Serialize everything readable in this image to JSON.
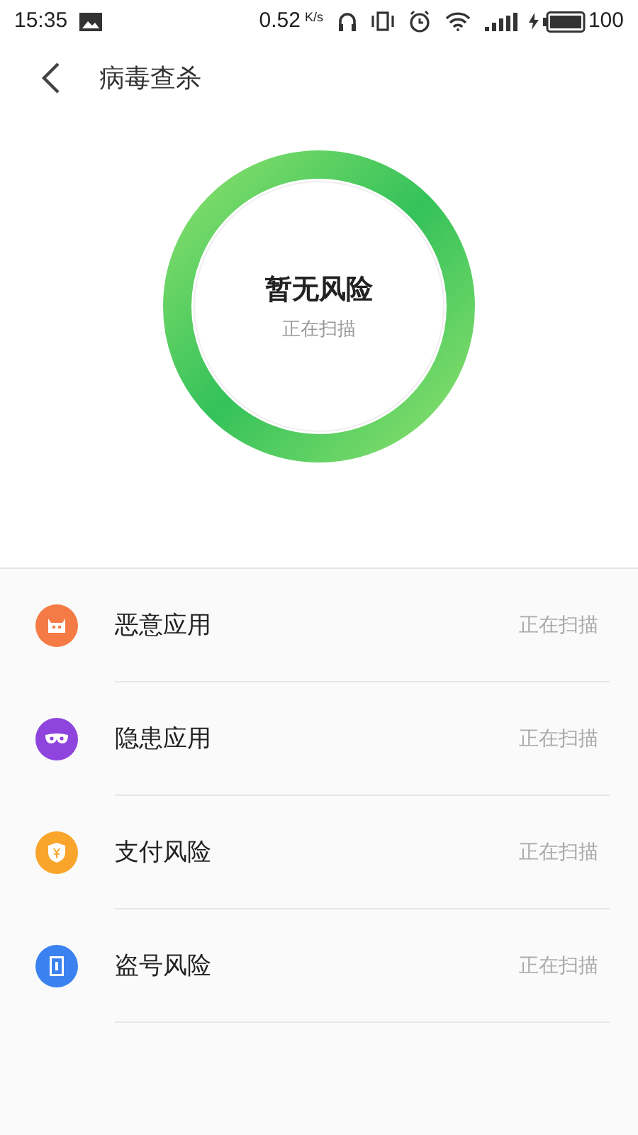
{
  "status_bar": {
    "time": "15:35",
    "speed": "0.52",
    "speed_unit": "K/s",
    "battery": "100"
  },
  "header": {
    "title": "病毒查杀"
  },
  "scan": {
    "headline": "暂无风险",
    "status": "正在扫描"
  },
  "items": [
    {
      "kind": "malware",
      "label": "恶意应用",
      "status": "正在扫描",
      "color": "#f47b45"
    },
    {
      "kind": "hidden",
      "label": "隐患应用",
      "status": "正在扫描",
      "color": "#8e44dd"
    },
    {
      "kind": "payment",
      "label": "支付风险",
      "status": "正在扫描",
      "color": "#f9a52b"
    },
    {
      "kind": "account",
      "label": "盗号风险",
      "status": "正在扫描",
      "color": "#3b82f0"
    }
  ]
}
